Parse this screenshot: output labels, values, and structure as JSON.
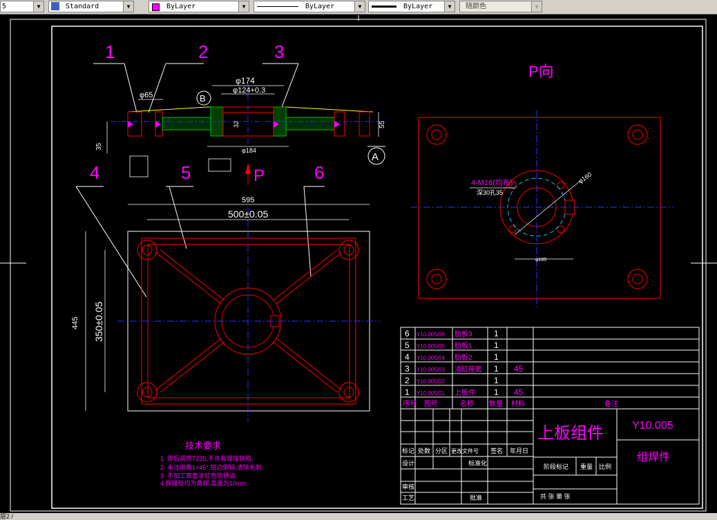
{
  "toolbar": {
    "layer_value": "5",
    "text_style": "Standard",
    "color": "ByLayer",
    "linetype": "ByLayer",
    "lineweight": "ByLayer",
    "plotstyle": "随颜色"
  },
  "status": {
    "text": "层2 /"
  },
  "drawing": {
    "balloons": [
      "1",
      "2",
      "3",
      "4",
      "5",
      "6"
    ],
    "view_label": "P向",
    "arrow_label": "P",
    "section_b": "B",
    "section_a": "A",
    "dims_top": [
      "φ174",
      "φ124+0.3",
      "φ65",
      "φ184",
      "35",
      "55",
      "32"
    ],
    "dims_plan": [
      "595",
      "500±0.05",
      "445",
      "350±0.05"
    ],
    "dims_pview": [
      "4-M16(均布)",
      "深30孔35",
      "φ160",
      "φ180"
    ],
    "colors": {
      "red": "#ff0000",
      "magenta": "#ff00ff",
      "blue": "#3030ff",
      "cyan": "#00c8ff",
      "white": "#ffffff",
      "yellow": "#ffff00",
      "green": "#00c000"
    }
  },
  "tech": {
    "title": "技术要求",
    "lines": [
      "1. 焊后调质T235,不许有焊接缺陷.",
      "2. 未注倒角1×45°,锐边倒钝,清除毛刺.",
      "3. 不加工表面涂红色防锈油.",
      "4.焊接处均为角焊,高度为10mm."
    ]
  },
  "bom": {
    "rows": [
      {
        "no": "6",
        "code": "Y10.005/06",
        "name": "肋板3",
        "qty": "1",
        "mat": ""
      },
      {
        "no": "5",
        "code": "Y10.005/05",
        "name": "肋板1",
        "qty": "1",
        "mat": ""
      },
      {
        "no": "4",
        "code": "Y10.005/04",
        "name": "肋板2",
        "qty": "1",
        "mat": ""
      },
      {
        "no": "3",
        "code": "Y10.005/03",
        "name": "油缸座套",
        "qty": "1",
        "mat": "45"
      },
      {
        "no": "2",
        "code": "Y10.005/02",
        "name": "",
        "qty": "1",
        "mat": ""
      },
      {
        "no": "1",
        "code": "Y10.005/01",
        "name": "上板件",
        "qty": "1",
        "mat": "45"
      }
    ],
    "header": {
      "no": "序号",
      "code": "图号",
      "name": "名称",
      "qty": "数量",
      "mat": "材料",
      "note": "备注"
    }
  },
  "title_block": {
    "part_name": "上板组件",
    "part_code": "Y10.005",
    "sub_name": "组焊件",
    "rev_headers": [
      "标记",
      "处数",
      "分区",
      "更改文件号",
      "签名",
      "年月日"
    ],
    "design": "设计",
    "standard": "标准化",
    "review": "审核",
    "process": "工艺",
    "approve": "批准",
    "stage": "阶段标记",
    "weight": "重量",
    "scale": "比例",
    "sheets": "共  张 第  张"
  }
}
